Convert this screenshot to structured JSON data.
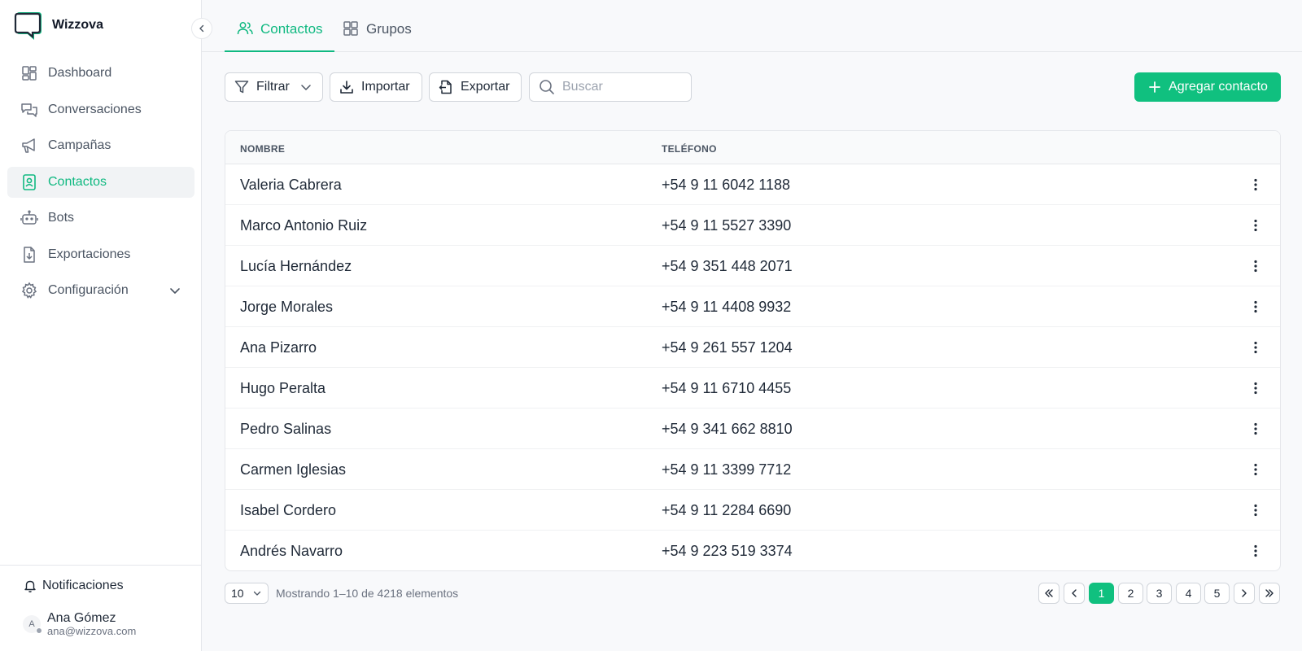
{
  "brand": {
    "name": "Wizzova",
    "accent": "#10b981"
  },
  "sidebar": {
    "items": [
      {
        "label": "Dashboard",
        "icon": "dashboard-icon"
      },
      {
        "label": "Conversaciones",
        "icon": "chat-icon"
      },
      {
        "label": "Campañas",
        "icon": "megaphone-icon"
      },
      {
        "label": "Contactos",
        "icon": "contact-book-icon",
        "active": true
      },
      {
        "label": "Bots",
        "icon": "bot-icon"
      },
      {
        "label": "Exportaciones",
        "icon": "file-download-icon"
      },
      {
        "label": "Configuración",
        "icon": "gear-icon"
      }
    ],
    "notifications_label": "Notificaciones",
    "user": {
      "initial": "A",
      "name": "Ana Gómez",
      "email": "ana@wizzova.com"
    }
  },
  "tabs": [
    {
      "label": "Contactos",
      "icon": "users-icon",
      "active": true
    },
    {
      "label": "Grupos",
      "icon": "grid-icon"
    }
  ],
  "toolbar": {
    "filter_label": "Filtrar",
    "import_label": "Importar",
    "export_label": "Exportar",
    "search_placeholder": "Buscar",
    "search_value": "",
    "add_label": "Agregar contacto"
  },
  "table": {
    "columns": [
      "NOMBRE",
      "TELÉFONO"
    ],
    "rows": [
      {
        "name": "Valeria Cabrera",
        "phone": "+54 9 11 6042 1188"
      },
      {
        "name": "Marco Antonio Ruiz",
        "phone": "+54 9 11 5527 3390"
      },
      {
        "name": "Lucía Hernández",
        "phone": "+54 9 351 448 2071"
      },
      {
        "name": "Jorge Morales",
        "phone": "+54 9 11 4408 9932"
      },
      {
        "name": "Ana Pizarro",
        "phone": "+54 9 261 557 1204"
      },
      {
        "name": "Hugo Peralta",
        "phone": "+54 9 11 6710 4455"
      },
      {
        "name": "Pedro Salinas",
        "phone": "+54 9 341 662 8810"
      },
      {
        "name": "Carmen Iglesias",
        "phone": "+54 9 11 3399 7712"
      },
      {
        "name": "Isabel Cordero",
        "phone": "+54 9 11 2284 6690"
      },
      {
        "name": "Andrés Navarro",
        "phone": "+54 9 223 519 3374"
      }
    ]
  },
  "pagination": {
    "page_size": "10",
    "showing_text": "Mostrando 1–10 de 4218 elementos",
    "pages": [
      "1",
      "2",
      "3",
      "4",
      "5"
    ],
    "current_page": "1"
  }
}
